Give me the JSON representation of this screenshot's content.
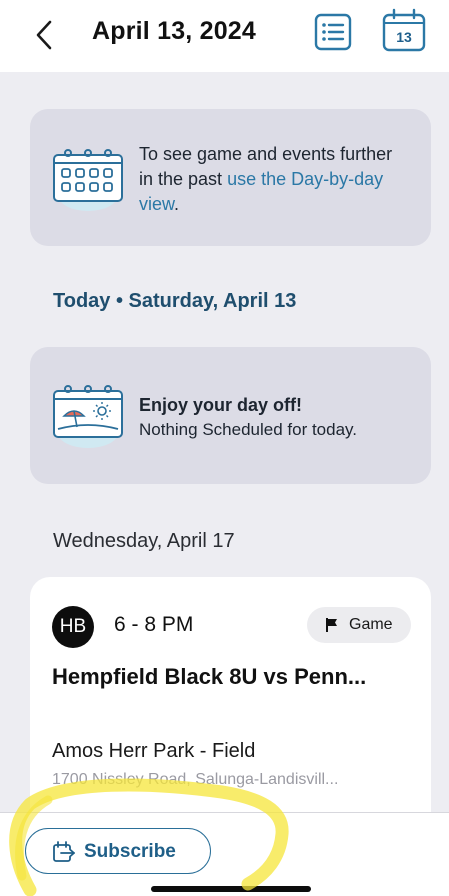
{
  "header": {
    "title": "April 13, 2024",
    "calendar_day": "13"
  },
  "info_card": {
    "text": "To see game and events further in the past ",
    "link": "use the Day-by-day view",
    "text_end": "."
  },
  "today": {
    "heading": "Today • Saturday, April 13",
    "title": "Enjoy your day off!",
    "subtitle": "Nothing Scheduled for today."
  },
  "upcoming": {
    "date": "Wednesday, April 17",
    "event": {
      "team_initials": "HB",
      "time": "6 - 8 PM",
      "type": "Game",
      "title": "Hempfield Black 8U vs Penn...",
      "location": "Amos Herr Park - Field",
      "address": "1700 Nissley Road, Salunga-Landisvill..."
    }
  },
  "footer": {
    "subscribe_label": "Subscribe"
  },
  "colors": {
    "accent": "#2b78a6",
    "heading_blue": "#1f4e6e",
    "card_bg": "#dcdce6",
    "page_bg": "#ededf2",
    "highlight": "#f5e53a"
  },
  "icons": {
    "back": "chevron-left-icon",
    "list": "list-icon",
    "calendar": "calendar-icon",
    "info": "calendar-grid-icon",
    "day_off": "beach-calendar-icon",
    "flag": "flag-icon",
    "subscribe": "calendar-export-icon"
  }
}
